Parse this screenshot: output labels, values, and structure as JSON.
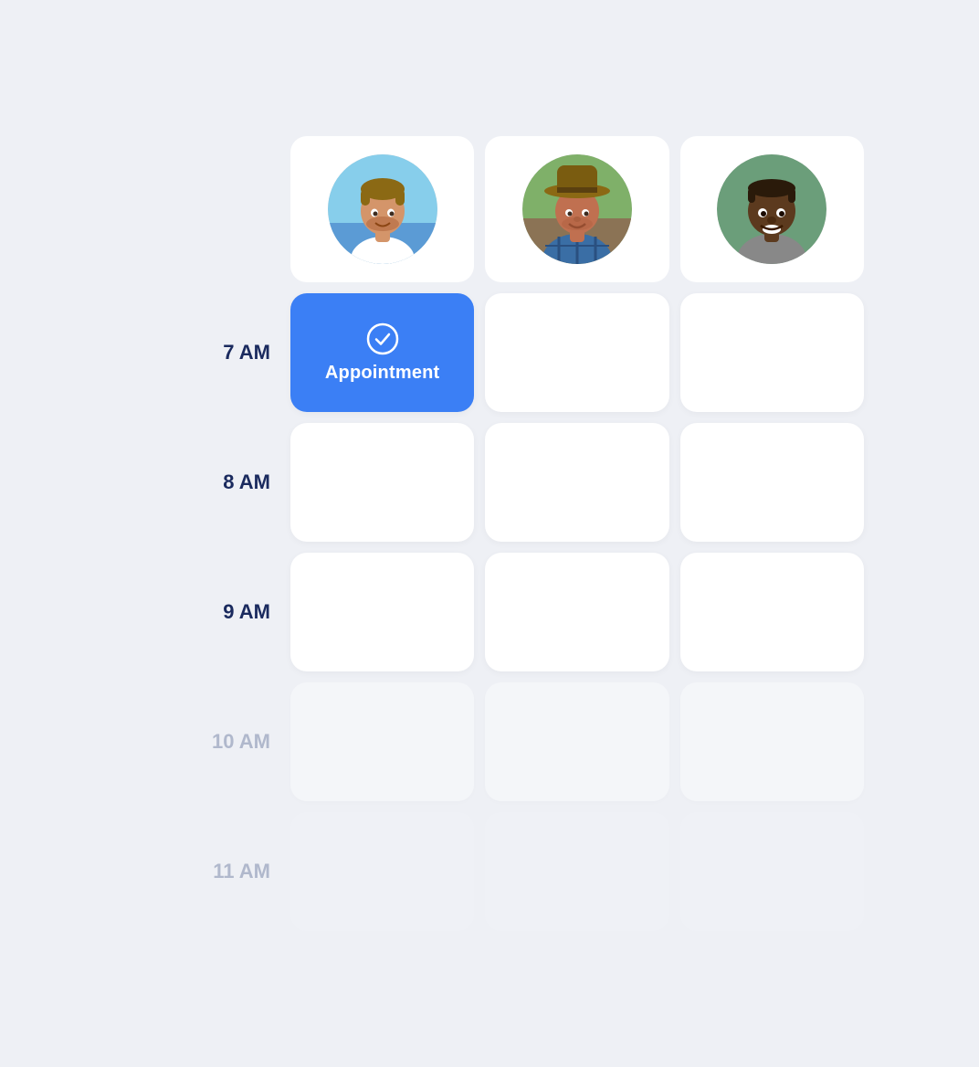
{
  "calendar": {
    "background": "#eef0f5",
    "accent_color": "#3b7ff5",
    "columns": [
      {
        "id": "time",
        "label": ""
      },
      {
        "id": "person1",
        "avatar": "person1"
      },
      {
        "id": "person2",
        "avatar": "person2"
      },
      {
        "id": "person3",
        "avatar": "person3"
      }
    ],
    "time_slots": [
      {
        "time": "7 AM",
        "muted": false,
        "slots": [
          {
            "type": "appointment",
            "label": "Appointment",
            "column": 1
          },
          {
            "type": "empty",
            "column": 2
          },
          {
            "type": "empty",
            "column": 3
          }
        ]
      },
      {
        "time": "8 AM",
        "muted": false,
        "slots": [
          {
            "type": "empty",
            "column": 1
          },
          {
            "type": "empty",
            "column": 2
          },
          {
            "type": "empty",
            "column": 3
          }
        ]
      },
      {
        "time": "9 AM",
        "muted": false,
        "slots": [
          {
            "type": "empty",
            "column": 1
          },
          {
            "type": "empty",
            "column": 2
          },
          {
            "type": "empty",
            "column": 3
          }
        ]
      },
      {
        "time": "10 AM",
        "muted": true,
        "slots": [
          {
            "type": "empty",
            "column": 1
          },
          {
            "type": "empty",
            "column": 2
          },
          {
            "type": "empty",
            "column": 3
          }
        ]
      },
      {
        "time": "11 AM",
        "muted": true,
        "slots": [
          {
            "type": "empty",
            "column": 1
          },
          {
            "type": "empty",
            "column": 2
          },
          {
            "type": "empty",
            "column": 3
          }
        ]
      }
    ],
    "appointment_label": "Appointment"
  }
}
